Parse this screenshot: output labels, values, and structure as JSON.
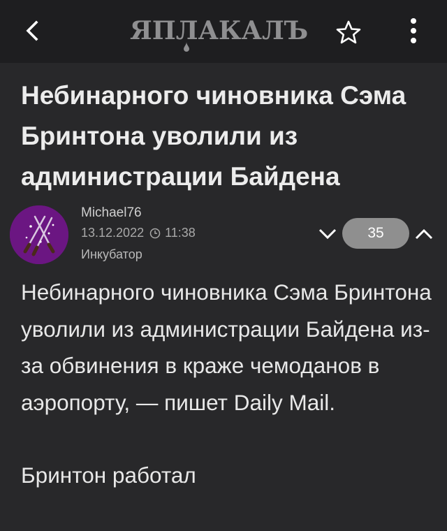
{
  "header": {
    "logo_text": "ЯПЛАКАЛЪ",
    "back_icon": "chevron-left-icon",
    "favorite_icon": "star-outline-icon",
    "menu_icon": "more-vertical-icon"
  },
  "post": {
    "title": "Небинарного чиновника Сэма Бринтона уволили из администрации Байдена",
    "author": "Michael76",
    "date": "13.12.2022",
    "time": "11:38",
    "category": "Инкубатор",
    "rating": "35",
    "paragraphs": [
      "Небинарного чиновника Сэма Бринтона уволили из администрации Байдена из-за обвинения в краже чемоданов в аэропорту, — пишет Daily Mail.",
      "Бринтон работал"
    ]
  },
  "colors": {
    "background": "#28282a",
    "topbar": "#1e1e20",
    "avatar": "#6b1682",
    "rating_pill": "#8f8f8f"
  }
}
